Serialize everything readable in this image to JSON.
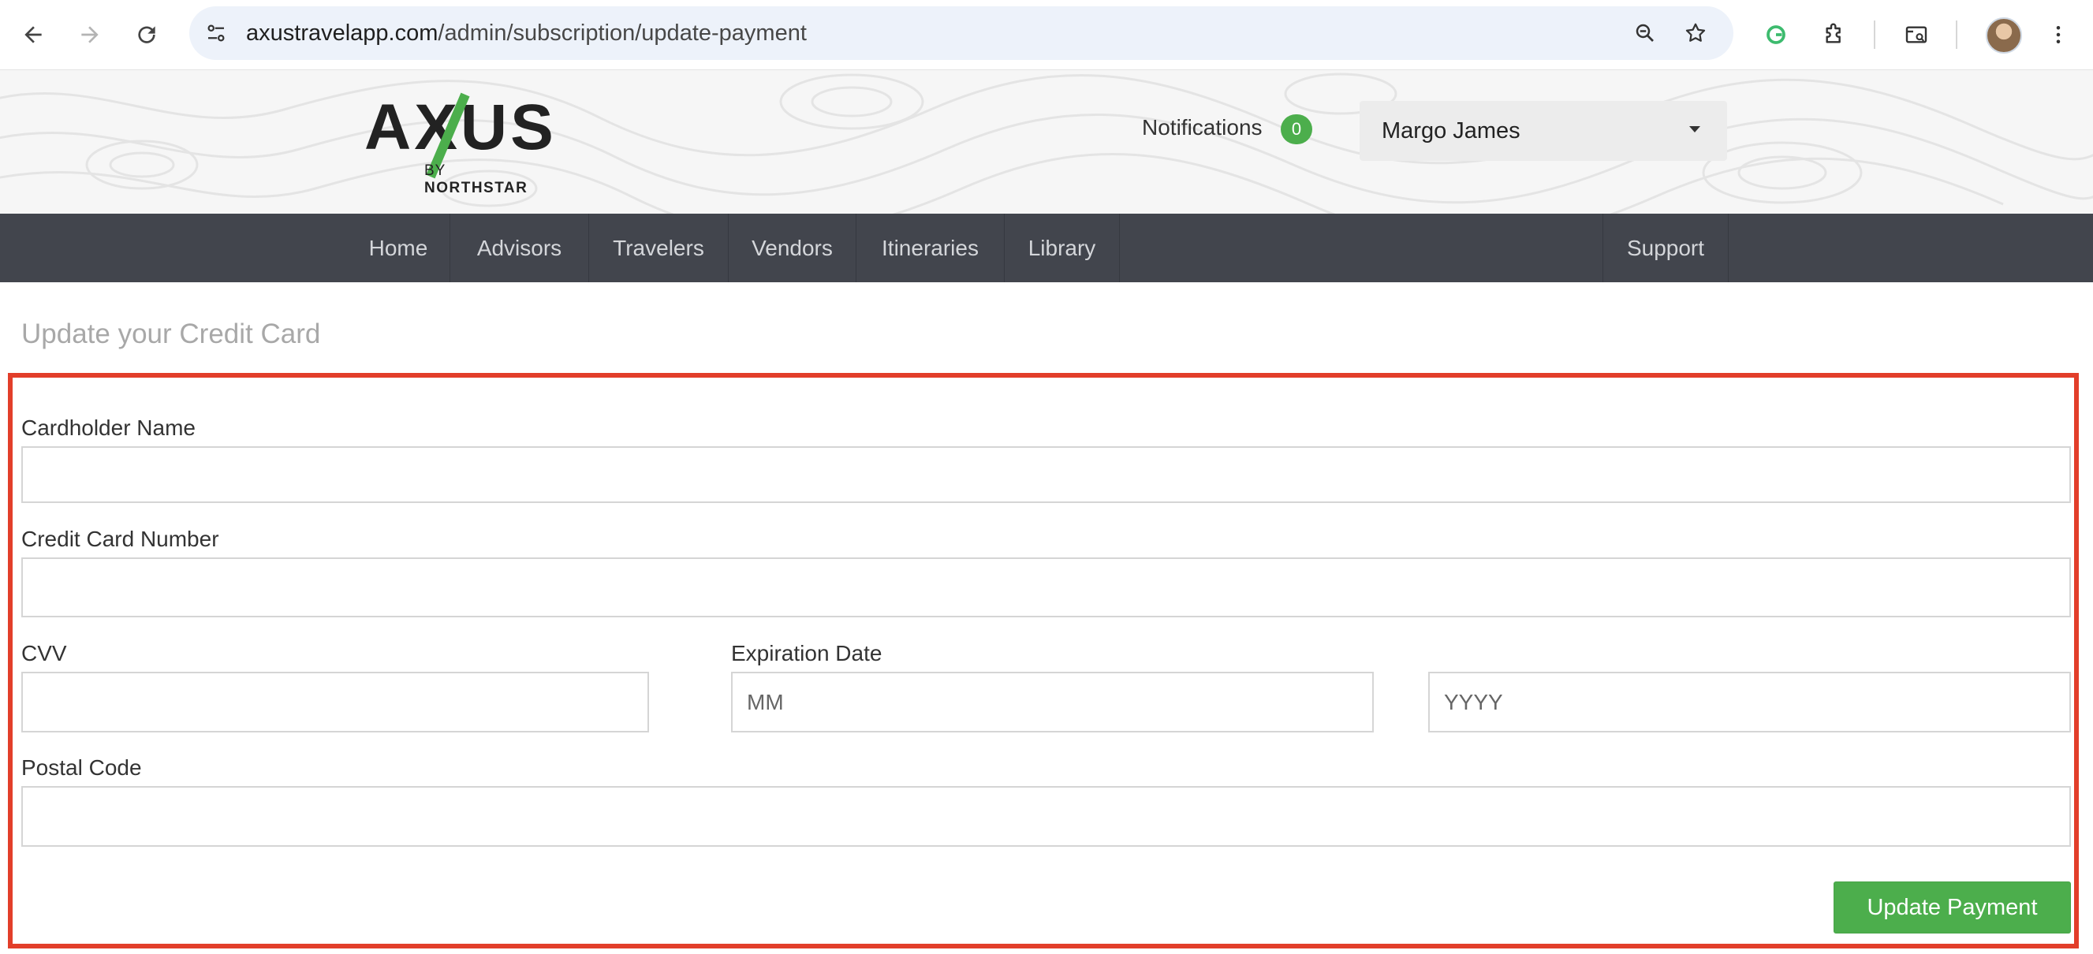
{
  "browser": {
    "url_host": "axustravelapp.com",
    "url_path": "/admin/subscription/update-payment"
  },
  "header": {
    "logo_wordmark": "AXUS",
    "logo_by": "BY",
    "logo_brand": "NORTHSTAR",
    "notifications_label": "Notifications",
    "notifications_count": "0",
    "user_name": "Margo James"
  },
  "nav": {
    "items": [
      "Home",
      "Advisors",
      "Travelers",
      "Vendors",
      "Itineraries",
      "Library"
    ],
    "support": "Support"
  },
  "page": {
    "title": "Update your Credit Card"
  },
  "form": {
    "cardholder_label": "Cardholder Name",
    "card_number_label": "Credit Card Number",
    "cvv_label": "CVV",
    "expiration_label": "Expiration Date",
    "month_placeholder": "MM",
    "year_placeholder": "YYYY",
    "postal_label": "Postal Code",
    "submit_label": "Update Payment"
  },
  "colors": {
    "nav_bg": "#42454d",
    "accent_green": "#4cae4c",
    "highlight_red": "#e23e2a",
    "omnibox_bg": "#edf2fa"
  }
}
